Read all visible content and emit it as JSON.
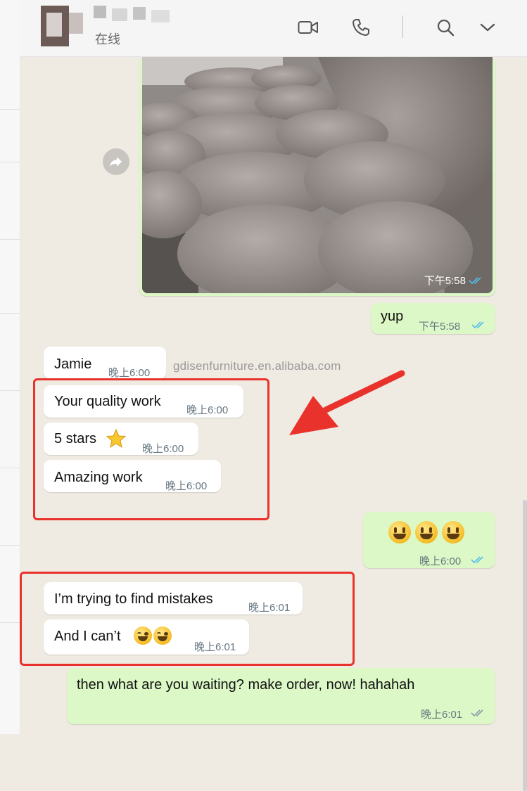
{
  "header": {
    "status": "在线"
  },
  "watermark": "gdisenfurniture.en.alibaba.com",
  "messages": {
    "photo_time": "下午5:58",
    "yup": {
      "text": "yup",
      "time": "下午5:58"
    },
    "jamie": {
      "text": "Jamie",
      "time": "晚上6:00"
    },
    "quality": {
      "text": "Your quality work",
      "time": "晚上6:00"
    },
    "stars": {
      "text": "5 stars",
      "time": "晚上6:00"
    },
    "amazing": {
      "text": "Amazing work",
      "time": "晚上6:00"
    },
    "smiles": {
      "time": "晚上6:00"
    },
    "trying": {
      "text": "I’m trying to find mistakes",
      "time": "晚上6:01"
    },
    "cant": {
      "text": "And I can’t",
      "time": "晚上6:01"
    },
    "reply": {
      "text": "then what are you waiting? make order, now! hahahah",
      "time": "晚上6:01"
    }
  },
  "colors": {
    "incoming_bubble": "#ffffff",
    "outgoing_bubble": "#dcf8c6",
    "highlight_box": "#e8322b",
    "read_ticks": "#53bdeb"
  },
  "icons": [
    "video-call-icon",
    "phone-icon",
    "search-icon",
    "chevron-down-icon",
    "forward-icon",
    "star-emoji",
    "grinning-face-emoji",
    "tears-of-joy-emoji",
    "double-check-icon",
    "red-arrow"
  ]
}
